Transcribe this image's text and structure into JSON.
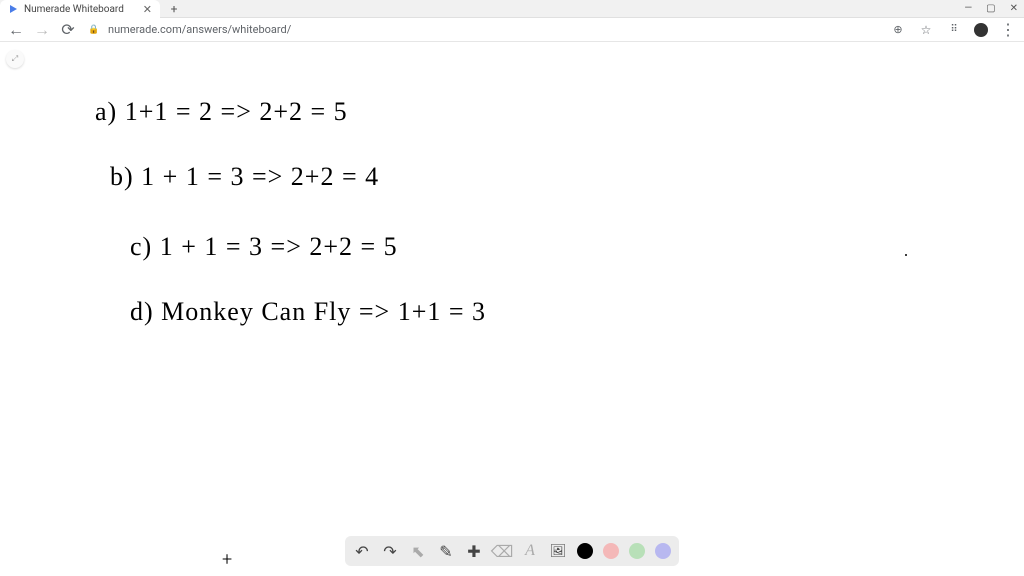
{
  "window": {
    "minimize": "—",
    "maximize": "▢",
    "close": "✕"
  },
  "tab": {
    "title": "Numerade Whiteboard",
    "close": "✕",
    "new_tab": "+"
  },
  "addressbar": {
    "url": "numerade.com/answers/whiteboard/",
    "search_glyph": "⊕",
    "star_glyph": "☆",
    "menu_glyph": "⋮",
    "puzzle_glyph": "⠿"
  },
  "nav": {
    "back": "←",
    "forward": "→",
    "reload": "⟳",
    "lock": "🔒"
  },
  "expand": {
    "glyph": "⤢"
  },
  "handwriting": {
    "line_a": "a)  1+1 = 2  =>   2+2 = 5",
    "line_b": "b)   1 + 1 = 3  =>  2+2 = 4",
    "line_c": "c)   1 + 1 = 3  =>  2+2 = 5",
    "line_d": "d)   Monkey Can Fly  =>  1+1 = 3"
  },
  "cursor": {
    "plus": "+"
  },
  "toolbar": {
    "undo": "↶",
    "redo": "↷",
    "pointer": "⬉",
    "pen": "✎",
    "add": "✚",
    "eraser": "⌫",
    "text": "A",
    "image": "🖼"
  }
}
